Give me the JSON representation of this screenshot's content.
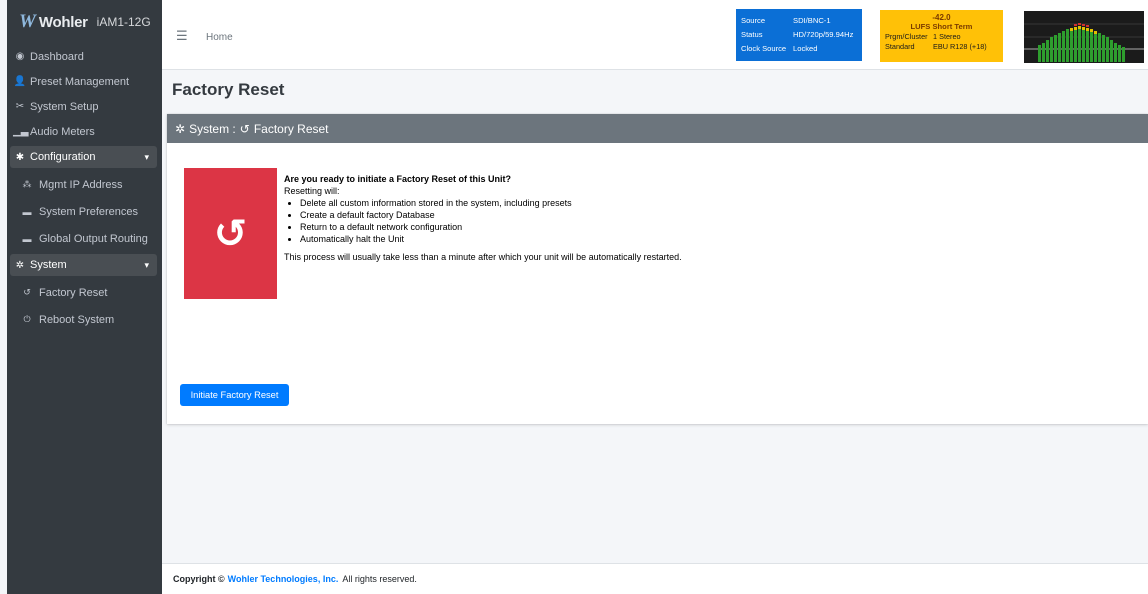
{
  "brand": {
    "logo_text": "Wohler",
    "model": "iAM1-12G"
  },
  "sidebar": {
    "items": [
      {
        "label": "Dashboard",
        "icon": "tachometer-icon"
      },
      {
        "label": "Preset Management",
        "icon": "user-cog-icon"
      },
      {
        "label": "System Setup",
        "icon": "tools-icon"
      },
      {
        "label": "Audio Meters",
        "icon": "chart-icon"
      }
    ],
    "groups": [
      {
        "label": "Configuration",
        "icon": "gear-icon",
        "children": [
          {
            "label": "Mgmt IP Address",
            "icon": "network-icon"
          },
          {
            "label": "System Preferences",
            "icon": "keyboard-icon"
          },
          {
            "label": "Global Output Routing",
            "icon": "keyboard-icon"
          }
        ]
      },
      {
        "label": "System",
        "icon": "gears-icon",
        "children": [
          {
            "label": "Factory Reset",
            "icon": "undo-icon"
          },
          {
            "label": "Reboot System",
            "icon": "power-icon"
          }
        ]
      }
    ]
  },
  "header": {
    "home_label": "Home",
    "status": {
      "rows": [
        {
          "key": "Source",
          "value": "SDI/BNC-1"
        },
        {
          "key": "Status",
          "value": "HD/720p/59.94Hz"
        },
        {
          "key": "Clock Source",
          "value": "Locked"
        }
      ]
    },
    "loudness": {
      "value": "-42.0",
      "title": "LUFS  Short Term",
      "rows": [
        {
          "key": "Prgm/Cluster",
          "value": "1  Stereo"
        },
        {
          "key": "Standard",
          "value": "EBU R128 (+18)"
        }
      ]
    },
    "colors": {
      "status_bg": "#0b6fd6",
      "loudness_bg": "#ffc107"
    }
  },
  "main": {
    "page_title": "Factory Reset",
    "card_title": "System : ⟲ Factory Reset",
    "card_title_prefix": "System :",
    "card_title_suffix": "Factory Reset",
    "question": "Are you ready to initiate a Factory Reset of this Unit?",
    "intro": "Resetting will:",
    "bullets": [
      "Delete all custom information stored in the system, including presets",
      "Create a default factory Database",
      "Return to a default network configuration",
      "Automatically halt the Unit"
    ],
    "note": "This process will usually take less than a minute after which your unit will be automatically restarted.",
    "button_label": "Initiate Factory Reset",
    "reset_color": "#dc3545",
    "button_color": "#007bff"
  },
  "footer": {
    "prefix": "Copyright ©",
    "company": "Wohler Technologies, Inc.",
    "suffix": "All rights reserved."
  }
}
